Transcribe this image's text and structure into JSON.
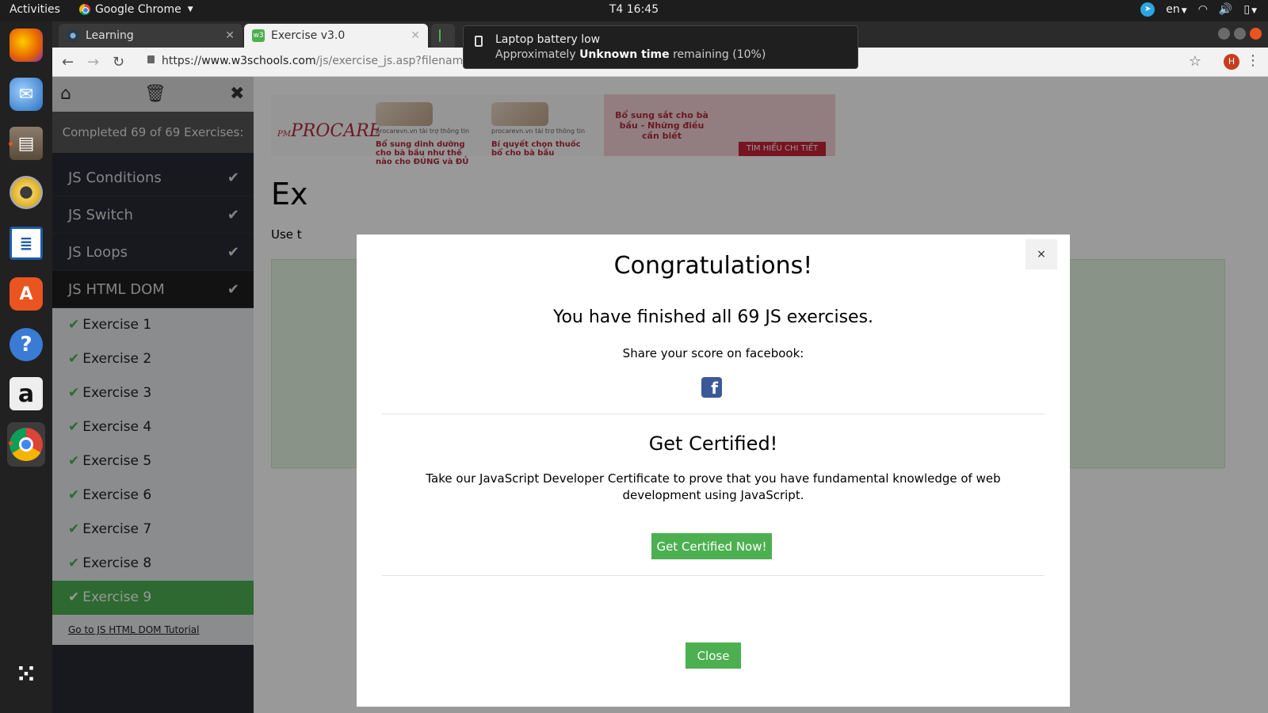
{
  "topbar": {
    "activities": "Activities",
    "app_name": "Google Chrome",
    "clock": "T4 16:45",
    "lang": "en"
  },
  "dock": {
    "items": [
      {
        "name": "firefox",
        "color": "#e66000",
        "glyph": "🦊"
      },
      {
        "name": "thunderbird",
        "color": "#2a6fbf",
        "glyph": "✉"
      },
      {
        "name": "files",
        "color": "#7a6a5a",
        "glyph": "▤"
      },
      {
        "name": "rhythmbox",
        "color": "#c8a020",
        "glyph": "◉"
      },
      {
        "name": "writer",
        "color": "#1e5aa8",
        "glyph": "▦"
      },
      {
        "name": "software",
        "color": "#e95420",
        "glyph": "A"
      },
      {
        "name": "help",
        "color": "#3a7bd5",
        "glyph": "?"
      },
      {
        "name": "amazon",
        "color": "#eeeeee",
        "glyph": "a"
      },
      {
        "name": "chrome",
        "color": "#ffffff",
        "glyph": "●"
      }
    ],
    "show_apps_glyph": "⠿"
  },
  "browser": {
    "tabs": [
      {
        "title": "Learning",
        "active": false
      },
      {
        "title": "Exercise v3.0",
        "active": true
      }
    ],
    "url_prefix": "https://",
    "url_host": "www.w3schools.com",
    "url_path": "/js/exercise_js.asp?filename=ex",
    "avatar_letter": "H"
  },
  "notification": {
    "title": "Laptop battery low",
    "line_prefix": "Approximately ",
    "line_bold": "Unknown time",
    "line_suffix": " remaining (10%)"
  },
  "sidebar": {
    "completed": "Completed 69 of 69 Exercises:",
    "categories": [
      {
        "label": "JS Conditions"
      },
      {
        "label": "JS Switch"
      },
      {
        "label": "JS Loops"
      },
      {
        "label": "JS HTML DOM"
      }
    ],
    "exercises": [
      "Exercise 1",
      "Exercise 2",
      "Exercise 3",
      "Exercise 4",
      "Exercise 5",
      "Exercise 6",
      "Exercise 7",
      "Exercise 8",
      "Exercise 9"
    ],
    "tutorial_link": "Go to JS HTML DOM Tutorial"
  },
  "content": {
    "title": "Ex",
    "instruction": "Use t",
    "ad": {
      "brand": "PROCARE",
      "brand_prefix": "PM",
      "blurb1": "Bổ sung dinh dưỡng cho bà bầu như thế nào cho ĐÚNG và ĐỦ",
      "blurb2": "Bí quyết chọn thuốc bổ cho bà bầu",
      "sponsor": "procarevn.vn tài trợ thông tin",
      "promo": "Bổ sung sắt cho bà bầu - Những điều cần biết",
      "cta": "TÌM HIỂU CHI TIẾT"
    }
  },
  "modal": {
    "close_x": "×",
    "heading": "Congratulations!",
    "finished": "You have finished all 69 JS exercises.",
    "share": "Share your score on facebook:",
    "fb_glyph": "f",
    "cert_heading": "Get Certified!",
    "cert_text": "Take our JavaScript Developer Certificate to prove that you have fundamental knowledge of web development using JavaScript.",
    "cert_button": "Get Certified Now!",
    "close_button": "Close"
  }
}
